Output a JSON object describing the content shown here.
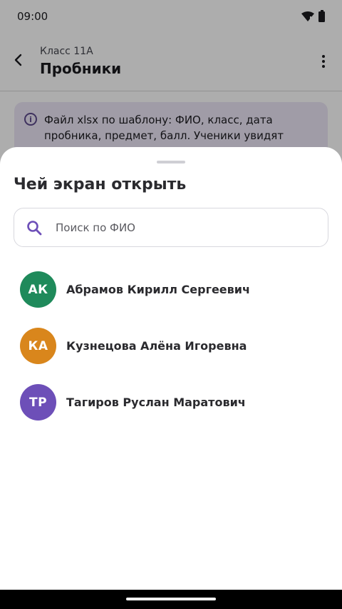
{
  "status_bar": {
    "time": "09:00"
  },
  "top_bar": {
    "subtitle": "Класс 11А",
    "title": "Пробники"
  },
  "info_card": {
    "text": "Файл xlsx по шаблону: ФИО, класс, дата пробника, предмет, балл. Ученики увидят данные только"
  },
  "sheet": {
    "title": "Чей экран открыть",
    "search": {
      "placeholder": "Поиск по ФИО",
      "value": ""
    },
    "students": [
      {
        "initials": "АК",
        "name": "Абрамов Кирилл Сергеевич",
        "color": "#1f8a5b"
      },
      {
        "initials": "КА",
        "name": "Кузнецова Алёна Игоревна",
        "color": "#d9861c"
      },
      {
        "initials": "ТР",
        "name": "Тагиров Руслан Маратович",
        "color": "#6d4fb8"
      }
    ]
  },
  "colors": {
    "accent": "#6d4fb8",
    "scrim": "rgba(0,0,0,0.32)"
  }
}
